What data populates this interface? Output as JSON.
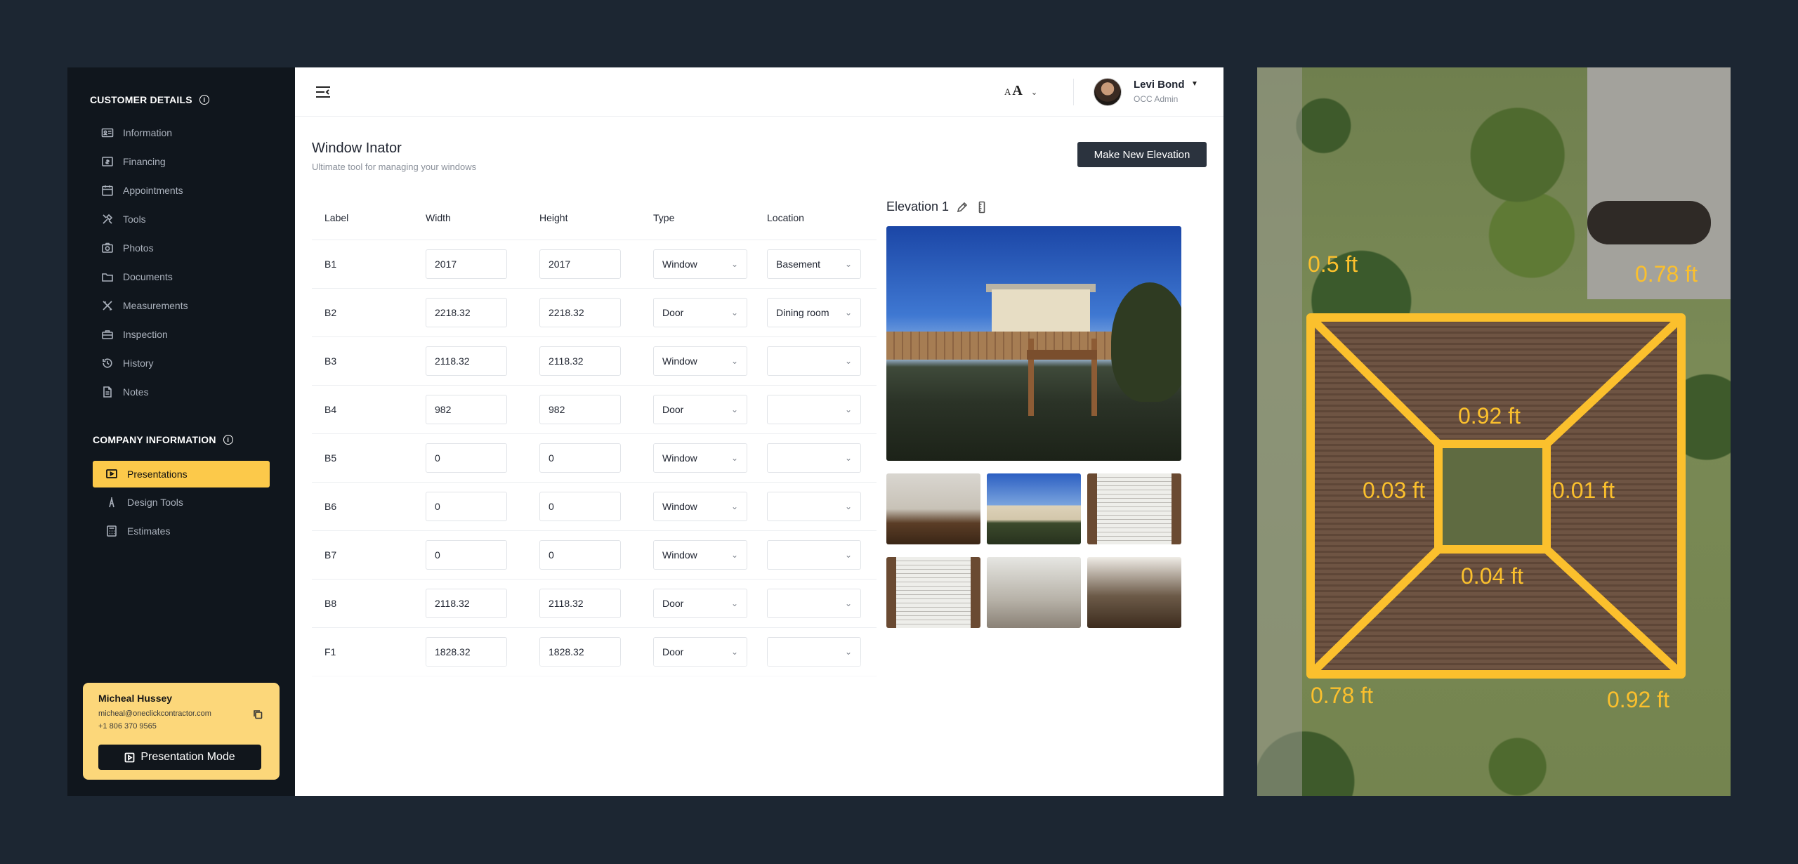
{
  "sidebar": {
    "customer_section": "CUSTOMER DETAILS",
    "customer_items": [
      {
        "label": "Information",
        "icon": "id-card-icon"
      },
      {
        "label": "Financing",
        "icon": "money-icon"
      },
      {
        "label": "Appointments",
        "icon": "calendar-icon"
      },
      {
        "label": "Tools",
        "icon": "tools-icon"
      },
      {
        "label": "Photos",
        "icon": "camera-icon"
      },
      {
        "label": "Documents",
        "icon": "folder-icon"
      },
      {
        "label": "Measurements",
        "icon": "ruler-icon"
      },
      {
        "label": "Inspection",
        "icon": "toolbox-icon"
      },
      {
        "label": "History",
        "icon": "history-icon"
      },
      {
        "label": "Notes",
        "icon": "note-icon"
      }
    ],
    "company_section": "COMPANY INFORMATION",
    "company_items": [
      {
        "label": "Presentations",
        "icon": "presentation-icon",
        "active": true
      },
      {
        "label": "Design Tools",
        "icon": "compass-icon"
      },
      {
        "label": "Estimates",
        "icon": "calculator-icon"
      }
    ],
    "customer_card": {
      "name": "Micheal Hussey",
      "email": "micheal@oneclickcontractor.com",
      "phone": "+1 806 370 9565",
      "button": "Presentation Mode"
    }
  },
  "header": {
    "user_name": "Levi Bond",
    "user_role": "OCC Admin",
    "font_small": "A",
    "font_big": "A"
  },
  "page": {
    "title": "Window Inator",
    "subtitle": "Ultimate tool for managing your windows",
    "new_button": "Make New Elevation"
  },
  "table": {
    "columns": [
      "Label",
      "Width",
      "Height",
      "Type",
      "Location"
    ],
    "rows": [
      {
        "label": "B1",
        "width": "2017",
        "height": "2017",
        "type": "Window",
        "location": "Basement"
      },
      {
        "label": "B2",
        "width": "2218.32",
        "height": "2218.32",
        "type": "Door",
        "location": "Dining room"
      },
      {
        "label": "B3",
        "width": "2118.32",
        "height": "2118.32",
        "type": "Window",
        "location": ""
      },
      {
        "label": "B4",
        "width": "982",
        "height": "982",
        "type": "Door",
        "location": ""
      },
      {
        "label": "B5",
        "width": "0",
        "height": "0",
        "type": "Window",
        "location": ""
      },
      {
        "label": "B6",
        "width": "0",
        "height": "0",
        "type": "Window",
        "location": ""
      },
      {
        "label": "B7",
        "width": "0",
        "height": "0",
        "type": "Window",
        "location": ""
      },
      {
        "label": "B8",
        "width": "2118.32",
        "height": "2118.32",
        "type": "Door",
        "location": ""
      },
      {
        "label": "F1",
        "width": "1828.32",
        "height": "1828.32",
        "type": "Door",
        "location": ""
      }
    ]
  },
  "elevation": {
    "title": "Elevation 1"
  },
  "aerial": {
    "labels": {
      "top_left": "0.5 ft",
      "top_right": "0.78 ft",
      "inner_top": "0.92 ft",
      "inner_left": "0.03 ft",
      "inner_right": "0.01 ft",
      "inner_bottom": "0.04 ft",
      "bottom_left": "0.78 ft",
      "bottom_right": "0.92 ft"
    },
    "accent": "#fbc02d"
  },
  "colors": {
    "sidebar_bg": "#10161d",
    "accent_yellow": "#fcc94a",
    "page_bg": "#1c2632",
    "primary_button": "#2b333e"
  }
}
